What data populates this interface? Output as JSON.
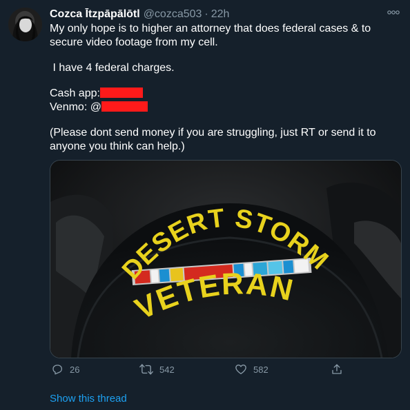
{
  "tweet": {
    "display_name": "Cozca Ītzpāpālōtl",
    "handle": "@cozca503",
    "separator": "·",
    "time": "22h",
    "lines": {
      "line1": "My only hope is to higher an attorney that does federal cases & to secure video footage from my cell.",
      "line2": "I have 4 federal charges.",
      "cashapp_label": "Cash app:",
      "venmo_label": "Venmo: @",
      "line5": "(Please dont send money if you are struggling,  just RT or send it to anyone you think can help.)"
    },
    "redaction_color": "#ff1a1a",
    "media": {
      "cap_text_top": "DESERT STORM",
      "cap_text_bottom": "VETERAN"
    },
    "actions": {
      "replies": "26",
      "retweets": "542",
      "likes": "582"
    },
    "show_thread": "Show this thread"
  },
  "colors": {
    "background": "#15202b",
    "secondary_text": "#8899a6",
    "link": "#1da1f2",
    "cap_text": "#e8d21d"
  },
  "icons": {
    "more": "more-dots-icon",
    "reply": "reply-icon",
    "retweet": "retweet-icon",
    "like": "heart-icon",
    "share": "share-icon"
  }
}
